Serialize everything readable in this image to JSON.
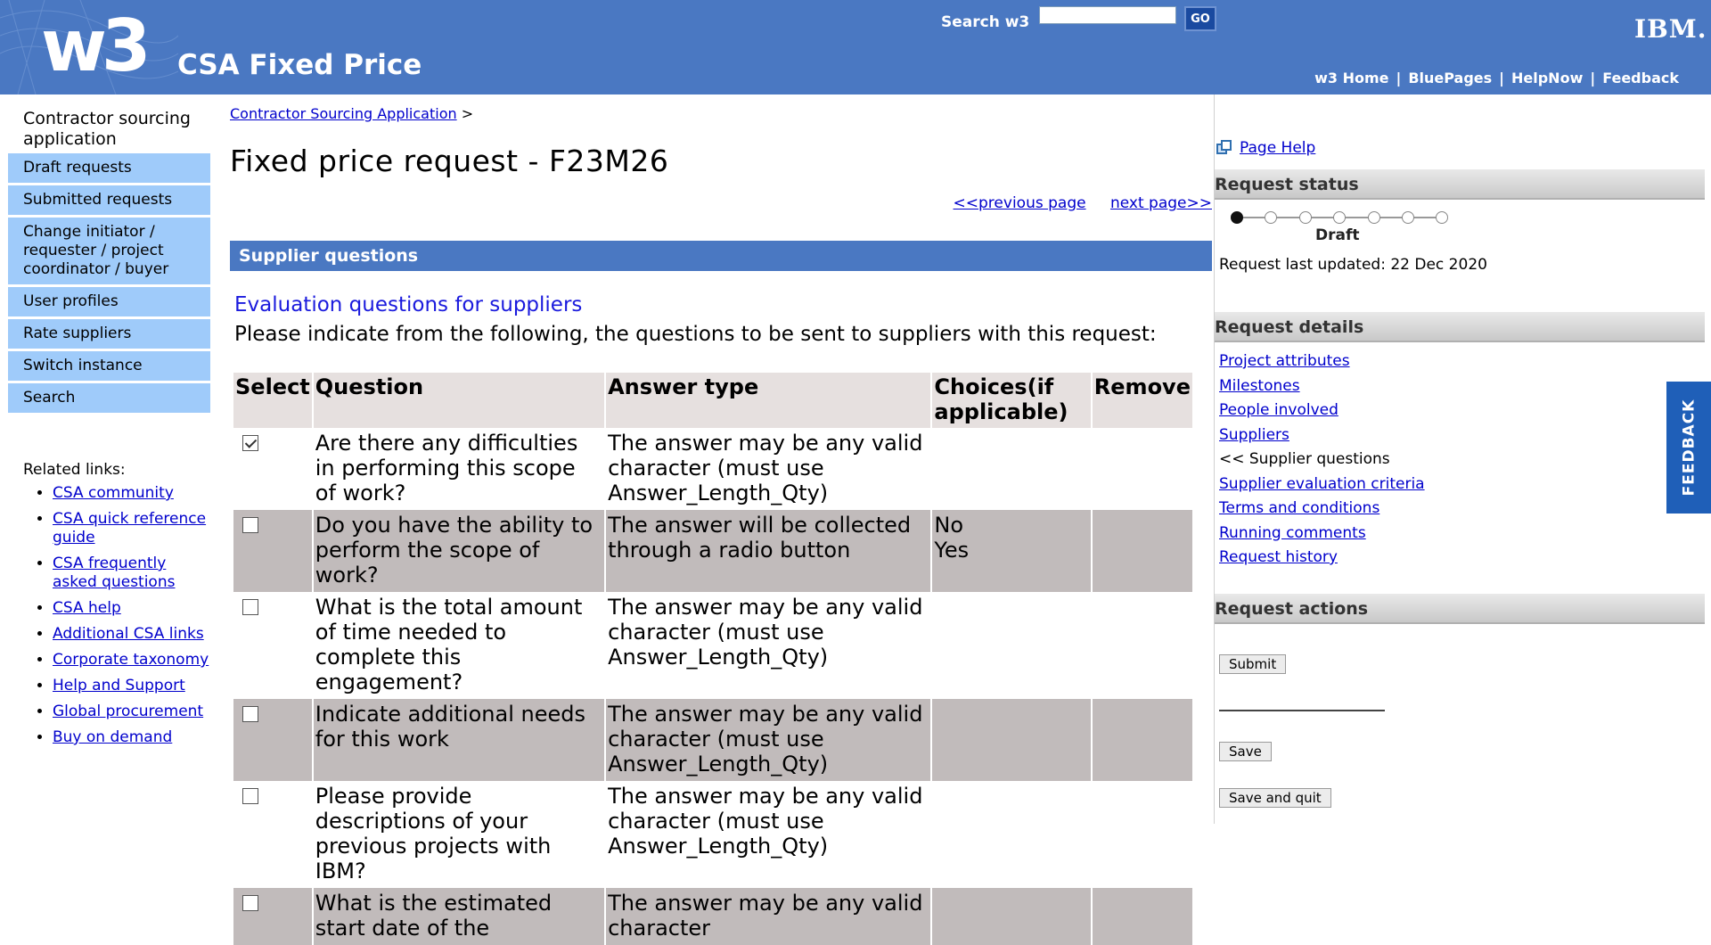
{
  "masthead": {
    "logo": "w3",
    "site_title": "CSA Fixed Price",
    "search_label": "Search w3",
    "search_value": "",
    "go_label": "GO",
    "ibm_logo": "IBM.",
    "links": [
      "w3 Home",
      "BluePages",
      "HelpNow",
      "Feedback"
    ]
  },
  "sidebar": {
    "title": "Contractor sourcing application",
    "items": [
      "Draft requests",
      "Submitted requests",
      "Change initiator / requester / project coordinator / buyer",
      "User profiles",
      "Rate suppliers",
      "Switch instance",
      "Search"
    ],
    "related_title": "Related links:",
    "related": [
      "CSA community",
      "CSA quick reference guide",
      "CSA frequently asked questions",
      "CSA help",
      "Additional CSA links",
      "Corporate taxonomy",
      "Help and Support",
      "Global procurement",
      "Buy on demand"
    ]
  },
  "main": {
    "breadcrumb": "Contractor Sourcing Application",
    "breadcrumb_sep": ">",
    "title": "Fixed price request - F23M26",
    "prev": "<<previous page",
    "next": "next page>>",
    "section": "Supplier questions",
    "eval_title": "Evaluation questions for suppliers",
    "eval_desc": "Please indicate from the following, the questions to be sent to suppliers with this request:",
    "table": {
      "headers": [
        "Select",
        "Question",
        "Answer type",
        "Choices(if applicable)",
        "Remove"
      ],
      "rows": [
        {
          "checked": true,
          "question": "Are there any difficulties in performing this scope of work?",
          "answer": "The answer may be any valid character (must use Answer_Length_Qty)",
          "choices": [
            "",
            ""
          ],
          "remove": ""
        },
        {
          "checked": false,
          "question": "Do you have the ability to perform the scope of work?",
          "answer": "The answer will be collected through a radio button",
          "choices": [
            "No",
            "Yes"
          ],
          "remove": ""
        },
        {
          "checked": false,
          "question": "What is the total amount of time needed to complete this engagement?",
          "answer": "The answer may be any valid character (must use Answer_Length_Qty)",
          "choices": [
            "",
            ""
          ],
          "remove": ""
        },
        {
          "checked": false,
          "question": "Indicate additional needs for this work",
          "answer": "The answer may be any valid character (must use Answer_Length_Qty)",
          "choices": [
            "",
            ""
          ],
          "remove": ""
        },
        {
          "checked": false,
          "question": "Please provide descriptions of your previous projects with IBM?",
          "answer": "The answer may be any valid character (must use Answer_Length_Qty)",
          "choices": [
            "",
            ""
          ],
          "remove": ""
        },
        {
          "checked": false,
          "question": "What is the estimated start date of the",
          "answer": "The answer may be any valid character",
          "choices": [
            "",
            ""
          ],
          "remove": ""
        }
      ]
    }
  },
  "right": {
    "page_help": "Page Help",
    "status_title": "Request status",
    "status_label": "Draft",
    "updated": "Request last updated: 22 Dec 2020",
    "details_title": "Request details",
    "details": [
      "Project attributes",
      "Milestones",
      "People involved",
      "Suppliers",
      "<< Supplier questions",
      "Supplier evaluation criteria",
      "Terms and conditions",
      "Running comments",
      "Request history"
    ],
    "actions_title": "Request actions",
    "submit": "Submit",
    "save": "Save",
    "save_quit": "Save and quit"
  },
  "feedback_tab": "FEEDBACK",
  "colors": {
    "masthead": "#4a78c2",
    "nav_item": "#9fcbfa",
    "row_shade": "#c1bbbb",
    "feedback": "#1f5fb8"
  }
}
